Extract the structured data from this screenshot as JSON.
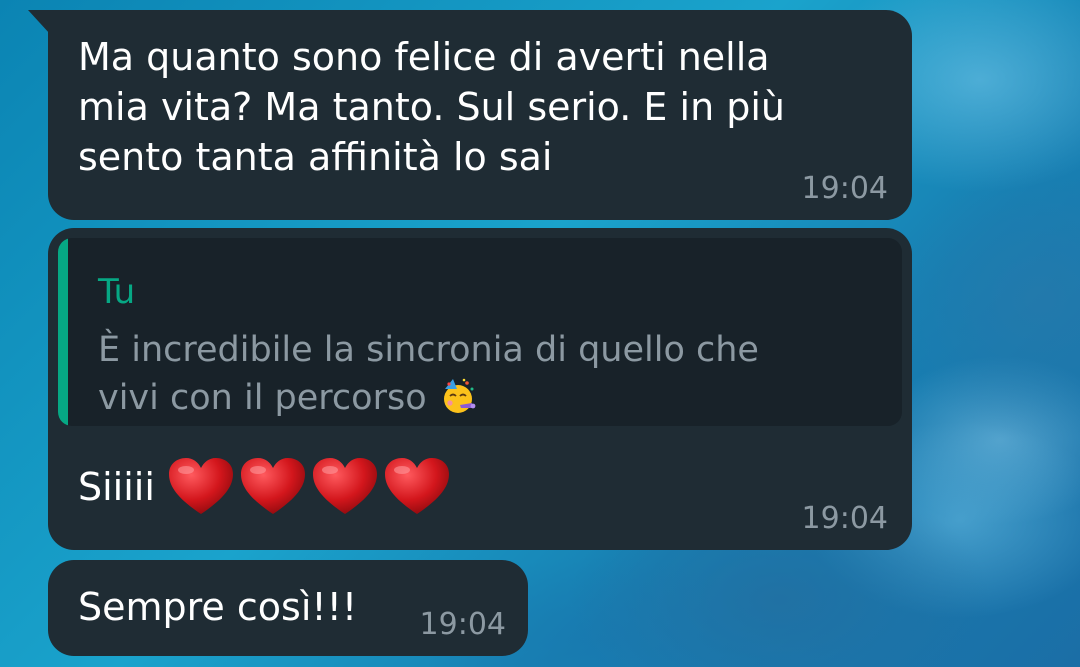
{
  "conversation": {
    "messages": [
      {
        "text": "Ma quanto sono felice di averti nella\nmia vita? Ma tanto. Sul serio. E in più\nsento tanta affinità lo sai",
        "time": "19:04"
      },
      {
        "quote": {
          "author": "Tu",
          "text": "È incredibile la sincronia di quello che\nvivi con il percorso",
          "emoji": "partying-face-icon"
        },
        "text": "Siiiii",
        "hearts": 4,
        "time": "19:04"
      },
      {
        "text": "Sempre così!!!",
        "time": "19:04"
      }
    ]
  },
  "colors": {
    "bubble": "#1f2c34",
    "quote_bg": "#182229",
    "quote_accent": "#06a884",
    "time": "#8c99a2",
    "heart": "#d3161c"
  }
}
